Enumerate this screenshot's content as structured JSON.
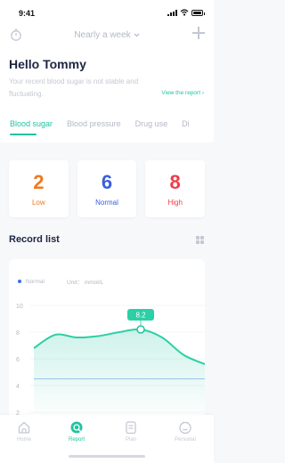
{
  "status": {
    "time": "9:41"
  },
  "nav": {
    "title": "Nearly a week"
  },
  "greeting": "Hello Tommy",
  "summary": "Your recent blood sugar is not stable and fluctuating.",
  "report_link": "View the report",
  "tabs": [
    {
      "label": "Blood sugar",
      "active": true
    },
    {
      "label": "Blood pressure",
      "active": false
    },
    {
      "label": "Drug use",
      "active": false
    },
    {
      "label": "Di",
      "active": false
    }
  ],
  "cards": [
    {
      "value": "2",
      "label": "Low",
      "color": "#f07a1e"
    },
    {
      "value": "6",
      "label": "Normal",
      "color": "#3a5fd9"
    },
    {
      "value": "8",
      "label": "High",
      "color": "#f03b4c"
    }
  ],
  "record_list": {
    "title": "Record list"
  },
  "chart": {
    "legend": "Normal",
    "unit": "Unit： mmol/L",
    "tooltip": "8.2"
  },
  "chart_data": {
    "type": "area",
    "series": [
      {
        "name": "Normal",
        "x": [
          0,
          1,
          2,
          3,
          4,
          5,
          6,
          7,
          8
        ],
        "values": [
          6.8,
          7.8,
          7.6,
          7.7,
          8.0,
          8.2,
          7.6,
          6.3,
          5.6
        ]
      }
    ],
    "highlight": {
      "x": 5,
      "value": 8.2
    },
    "reference_line": 4.5,
    "yticks": [
      "10",
      "8",
      "6",
      "4",
      "2"
    ],
    "ylim": [
      2,
      10
    ],
    "grid": true
  },
  "bottom_nav": [
    {
      "label": "Home",
      "icon": "home-icon",
      "active": false
    },
    {
      "label": "Report",
      "icon": "report-icon",
      "active": true
    },
    {
      "label": "Plan",
      "icon": "plan-icon",
      "active": false
    },
    {
      "label": "Personal",
      "icon": "personal-icon",
      "active": false
    }
  ],
  "colors": {
    "accent": "#22c3a0",
    "text": "#1d2541",
    "muted": "#b3b8c4"
  }
}
